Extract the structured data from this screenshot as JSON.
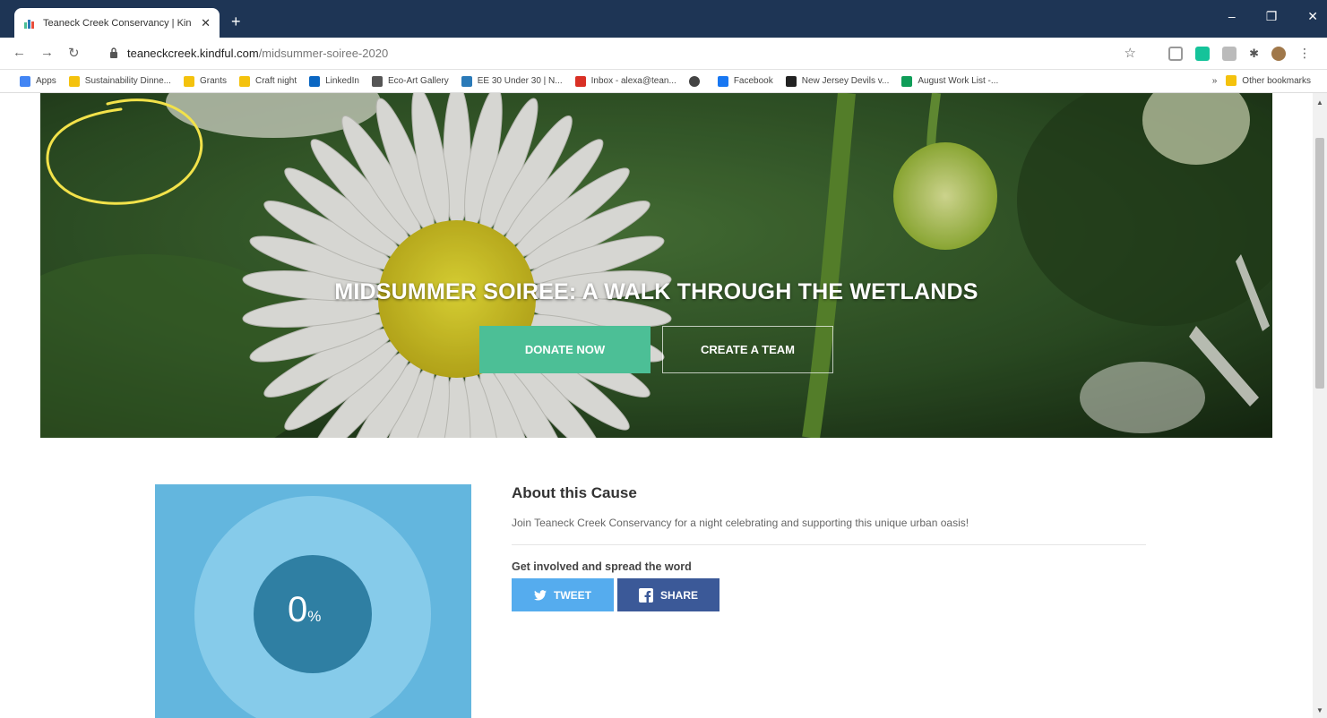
{
  "browser": {
    "tab_title": "Teaneck Creek Conservancy | Kin",
    "tab_close": "✕",
    "new_tab": "+",
    "window_controls": [
      "–",
      "❐",
      "✕"
    ],
    "url_host": "teaneckcreek.kindful.com",
    "url_path": "/midsummer-soiree-2020",
    "bookmarks": [
      {
        "label": "Apps",
        "icon": "apps-grid-icon",
        "color": "#4285f4"
      },
      {
        "label": "Sustainability Dinne...",
        "icon": "folder-icon",
        "color": "#f4c20d"
      },
      {
        "label": "Grants",
        "icon": "folder-icon",
        "color": "#f4c20d"
      },
      {
        "label": "Craft night",
        "icon": "folder-icon",
        "color": "#f4c20d"
      },
      {
        "label": "LinkedIn",
        "icon": "linkedin-icon",
        "color": "#0a66c2"
      },
      {
        "label": "Eco-Art Gallery",
        "icon": "eco-art-icon",
        "color": "#555555"
      },
      {
        "label": "EE 30 Under 30 | N...",
        "icon": "ee-icon",
        "color": "#2a7ab8"
      },
      {
        "label": "Inbox - alexa@tean...",
        "icon": "gmail-icon",
        "color": "#d93025"
      },
      {
        "label": "",
        "icon": "globe-icon",
        "color": "#444444"
      },
      {
        "label": "Facebook",
        "icon": "facebook-icon",
        "color": "#1877f2"
      },
      {
        "label": "New Jersey Devils v...",
        "icon": "devils-icon",
        "color": "#222222"
      },
      {
        "label": "August Work List -...",
        "icon": "sheets-icon",
        "color": "#0f9d58"
      }
    ],
    "bookmarks_overflow": "»",
    "other_bookmarks": "Other bookmarks"
  },
  "hero": {
    "title": "MIDSUMMER SOIREE: A WALK THROUGH THE WETLANDS",
    "donate_label": "DONATE NOW",
    "team_label": "CREATE A TEAM"
  },
  "progress": {
    "value": 0,
    "number": "0",
    "symbol": "%"
  },
  "about": {
    "heading": "About this Cause",
    "description": "Join Teaneck Creek Conservancy for a night celebrating and supporting this unique urban oasis!",
    "involved": "Get involved and spread the word",
    "tweet_label": "TWEET",
    "share_label": "SHARE"
  },
  "colors": {
    "titlebar": "#1e3555",
    "donate": "#4cbf96",
    "tweet": "#55acee",
    "share": "#3b5998",
    "progress_bg": "#63b6de",
    "annotation": "#f2e24a"
  }
}
